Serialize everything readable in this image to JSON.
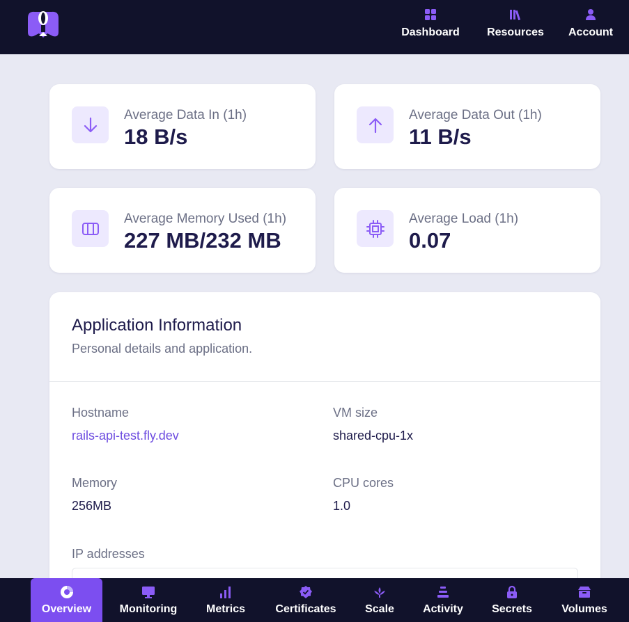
{
  "nav": {
    "items": [
      {
        "label": "Dashboard",
        "icon": "grid-icon"
      },
      {
        "label": "Resources",
        "icon": "library-icon"
      },
      {
        "label": "Account",
        "icon": "user-icon"
      }
    ]
  },
  "stats": [
    {
      "label": "Average Data In (1h)",
      "value": "18 B/s",
      "icon": "arrow-down-icon"
    },
    {
      "label": "Average Data Out (1h)",
      "value": "11 B/s",
      "icon": "arrow-up-icon"
    },
    {
      "label": "Average Memory Used (1h)",
      "value": "227 MB/232 MB",
      "icon": "memory-icon"
    },
    {
      "label": "Average Load (1h)",
      "value": "0.07",
      "icon": "cpu-icon"
    }
  ],
  "app_info": {
    "title": "Application Information",
    "subtitle": "Personal details and application.",
    "hostname_label": "Hostname",
    "hostname_value": "rails-api-test.fly.dev",
    "vm_size_label": "VM size",
    "vm_size_value": "shared-cpu-1x",
    "memory_label": "Memory",
    "memory_value": "256MB",
    "cpu_label": "CPU cores",
    "cpu_value": "1.0",
    "ip_label": "IP addresses"
  },
  "bottom_nav": {
    "items": [
      {
        "label": "Overview",
        "icon": "overview-icon",
        "active": true
      },
      {
        "label": "Monitoring",
        "icon": "monitor-icon"
      },
      {
        "label": "Metrics",
        "icon": "bar-chart-icon"
      },
      {
        "label": "Certificates",
        "icon": "badge-check-icon"
      },
      {
        "label": "Scale",
        "icon": "scale-icon"
      },
      {
        "label": "Activity",
        "icon": "stack-icon"
      },
      {
        "label": "Secrets",
        "icon": "lock-icon"
      },
      {
        "label": "Volumes",
        "icon": "archive-icon"
      }
    ]
  },
  "colors": {
    "nav_bg": "#11122b",
    "accent": "#7c4ef0",
    "icon_bg": "#ede9fe",
    "page_bg": "#e8e9f3"
  }
}
